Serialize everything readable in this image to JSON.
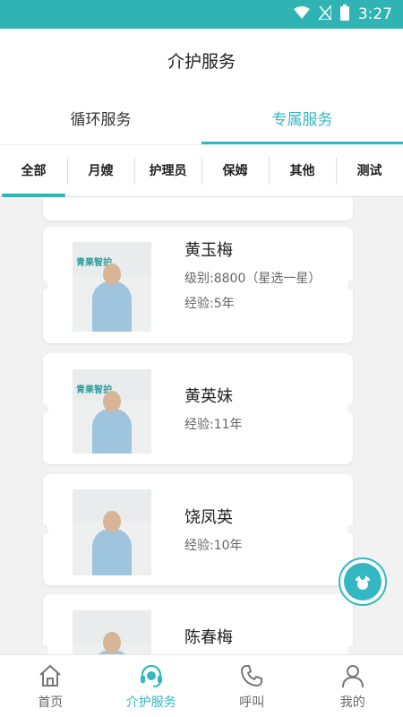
{
  "status_bar": {
    "time": "3:27"
  },
  "header": {
    "title": "介护服务"
  },
  "tabs": [
    {
      "label": "循环服务"
    },
    {
      "label": "专属服务"
    }
  ],
  "categories": [
    {
      "label": "全部"
    },
    {
      "label": "月嫂"
    },
    {
      "label": "护理员"
    },
    {
      "label": "保姆"
    },
    {
      "label": "其他"
    },
    {
      "label": "测试"
    }
  ],
  "photo_logo": "青果智护",
  "caregivers": [
    {
      "name": "黄玉梅",
      "level": "级别:8800（星选一星）",
      "experience": "经验:5年"
    },
    {
      "name": "黄英妹",
      "experience": "经验:11年"
    },
    {
      "name": "饶凤英",
      "experience": "经验:10年"
    },
    {
      "name": "陈春梅"
    }
  ],
  "bottom_nav": [
    {
      "label": "首页",
      "icon": "home-icon"
    },
    {
      "label": "介护服务",
      "icon": "headset-icon"
    },
    {
      "label": "呼叫",
      "icon": "phone-icon"
    },
    {
      "label": "我的",
      "icon": "user-icon"
    }
  ],
  "colors": {
    "accent": "#35b7c3",
    "status_bar": "#2fb3b3"
  }
}
